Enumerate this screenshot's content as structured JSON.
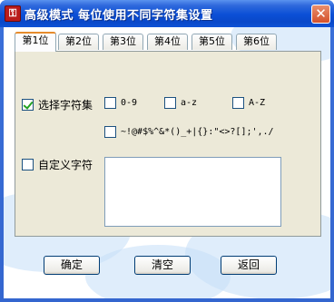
{
  "window": {
    "title": "高级模式   每位使用不同字符集设置",
    "app_icon": "app-icon",
    "close_glyph": "✕"
  },
  "tabs": [
    {
      "label": "第1位",
      "active": true
    },
    {
      "label": "第2位",
      "active": false
    },
    {
      "label": "第3位",
      "active": false
    },
    {
      "label": "第4位",
      "active": false
    },
    {
      "label": "第5位",
      "active": false
    },
    {
      "label": "第6位",
      "active": false
    }
  ],
  "options": {
    "select_charset": {
      "label": "选择字符集",
      "checked": true
    },
    "digits": {
      "label": "0-9",
      "checked": false
    },
    "lower": {
      "label": "a-z",
      "checked": false
    },
    "upper": {
      "label": "A-Z",
      "checked": false
    },
    "symbols": {
      "label": "~!@#$%^&*()_+|{}:\"<>?[];',./",
      "checked": false
    },
    "custom_charset": {
      "label": "自定义字符",
      "checked": false
    }
  },
  "custom_text": {
    "value": ""
  },
  "buttons": {
    "ok": "确定",
    "clear": "清空",
    "back": "返回"
  }
}
